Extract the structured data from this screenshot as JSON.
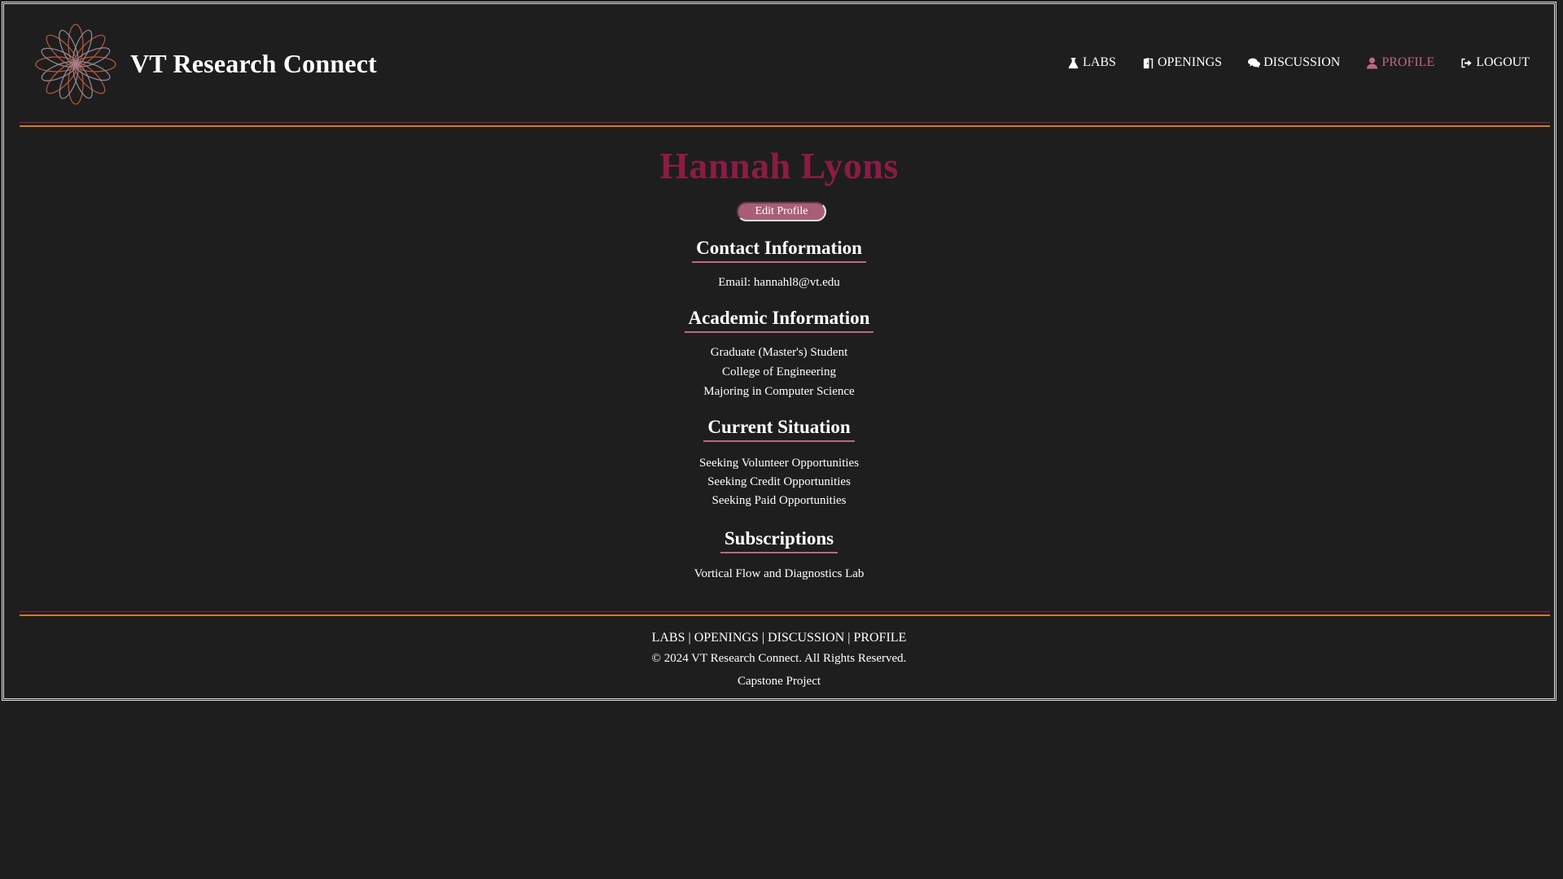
{
  "header": {
    "site_title": "VT Research Connect",
    "nav": [
      {
        "label": "LABS",
        "icon": "flask-icon"
      },
      {
        "label": "OPENINGS",
        "icon": "door-icon"
      },
      {
        "label": "DISCUSSION",
        "icon": "comments-icon"
      },
      {
        "label": "PROFILE",
        "icon": "user-icon",
        "active": true
      },
      {
        "label": "LOGOUT",
        "icon": "logout-icon"
      }
    ]
  },
  "profile": {
    "name": "Hannah Lyons",
    "edit_label": "Edit Profile",
    "contact": {
      "title": "Contact Information",
      "email_line": "Email: hannahl8@vt.edu"
    },
    "academic": {
      "title": "Academic Information",
      "lines": [
        "Graduate (Master's) Student",
        "College of Engineering",
        "Majoring in Computer Science"
      ]
    },
    "situation": {
      "title": "Current Situation",
      "lines": [
        "Seeking Volunteer Opportunities",
        "Seeking Credit Opportunities",
        "Seeking Paid Opportunities"
      ]
    },
    "subscriptions": {
      "title": "Subscriptions",
      "lines": [
        "Vortical Flow and Diagnostics Lab"
      ]
    }
  },
  "footer": {
    "links": [
      "LABS",
      "OPENINGS",
      "DISCUSSION",
      "PROFILE"
    ],
    "separator": "|",
    "copyright": "© 2024 VT Research Connect. All Rights Reserved.",
    "note": "Capstone Project"
  },
  "colors": {
    "background": "#1e1e1e",
    "accent_maroon": "#8a1c44",
    "accent_pink": "#c06685",
    "accent_orange": "#d2782d",
    "button": "#a85e78"
  }
}
